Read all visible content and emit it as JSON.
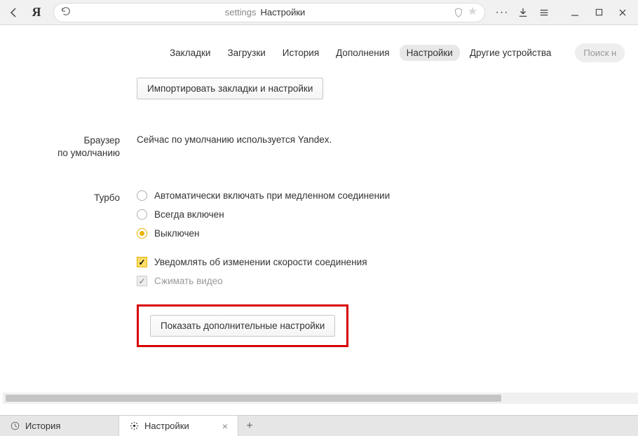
{
  "toolbar": {
    "url_key": "settings",
    "url_title": "Настройки"
  },
  "nav": {
    "items": [
      "Закладки",
      "Загрузки",
      "История",
      "Дополнения",
      "Настройки",
      "Другие устройства"
    ],
    "active_index": 4,
    "search_placeholder": "Поиск н"
  },
  "import_button": "Импортировать закладки и настройки",
  "default_browser": {
    "label": "Браузер\nпо умолчанию",
    "text": "Сейчас по умолчанию используется Yandex."
  },
  "turbo": {
    "label": "Турбо",
    "options": [
      "Автоматически включать при медленном соединении",
      "Всегда включен",
      "Выключен"
    ],
    "selected_index": 2,
    "notify": {
      "label": "Уведомлять об изменении скорости соединения",
      "checked": true,
      "disabled": false
    },
    "compress": {
      "label": "Сжимать видео",
      "checked": true,
      "disabled": true
    }
  },
  "advanced_button": "Показать дополнительные настройки",
  "tabs": [
    {
      "icon": "history-icon",
      "label": "История",
      "active": false,
      "closable": false
    },
    {
      "icon": "gear-icon",
      "label": "Настройки",
      "active": true,
      "closable": true
    }
  ]
}
